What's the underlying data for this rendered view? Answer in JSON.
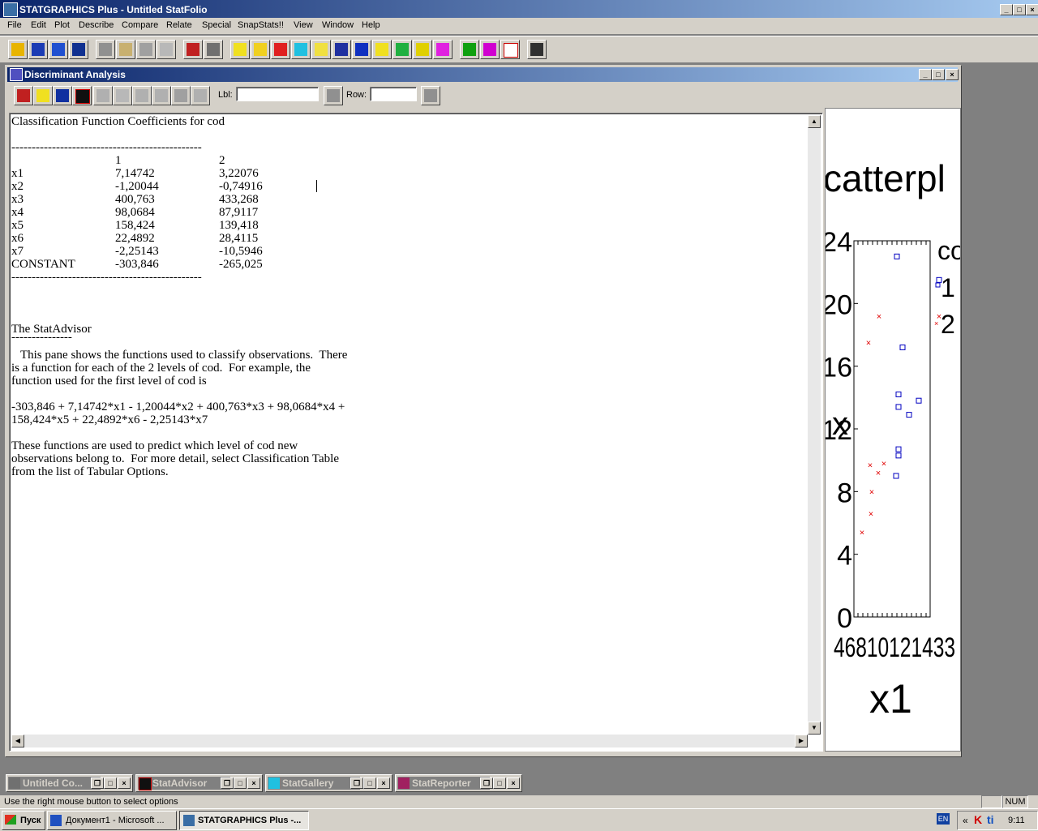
{
  "app": {
    "title": "STATGRAPHICS Plus - Untitled StatFolio",
    "min": "_",
    "max": "□",
    "close": "×"
  },
  "menu": [
    "File",
    "Edit",
    "Plot",
    "Describe",
    "Compare",
    "Relate",
    "Special",
    "SnapStats!!",
    "View",
    "Window",
    "Help"
  ],
  "child": {
    "title": "Discriminant Analysis",
    "lbl_label": "Lbl:",
    "row_label": "Row:",
    "lbl_value": "",
    "row_value": ""
  },
  "output": {
    "heading": "Classification Function Coefficients for cod",
    "rule": "-----------------------------------------------",
    "col_headers": [
      "",
      "1",
      "2"
    ],
    "rows": [
      [
        "x1",
        "7,14742",
        "3,22076"
      ],
      [
        "x2",
        "-1,20044",
        "-0,74916"
      ],
      [
        "x3",
        "400,763",
        "433,268"
      ],
      [
        "x4",
        "98,0684",
        "87,9117"
      ],
      [
        "x5",
        "158,424",
        "139,418"
      ],
      [
        "x6",
        "22,4892",
        "28,4115"
      ],
      [
        "x7",
        "-2,25143",
        "-10,5946"
      ],
      [
        "CONSTANT",
        "-303,846",
        "-265,025"
      ]
    ],
    "advisor_title": "The StatAdvisor",
    "advisor_rule": "---------------",
    "advisor_p1": [
      "   This pane shows the functions used to classify observations.  There",
      "is a function for each of the 2 levels of cod.  For example, the",
      "function used for the first level of cod is"
    ],
    "advisor_p2": [
      "-303,846 + 7,14742*x1 - 1,20044*x2 + 400,763*x3 + 98,0684*x4 +",
      "158,424*x5 + 22,4892*x6 - 2,25143*x7"
    ],
    "advisor_p3": [
      "These functions are used to predict which level of cod new",
      "observations belong to.  For more detail, select Classification Table",
      "from the list of Tabular Options."
    ]
  },
  "graph": {
    "title_fragment": "catterpl",
    "legend_fragment": "co",
    "legend_items": [
      "1",
      "2"
    ],
    "y_ticks": [
      "24",
      "20",
      "16",
      "12",
      "8",
      "4",
      "0"
    ],
    "x_ticks_overlap": "46810121433",
    "xlabel": "x1",
    "ylabel_fragment": "x",
    "colors": {
      "group1": "#0000c0",
      "group2": "#e00000"
    }
  },
  "chart_data": {
    "type": "scatter",
    "title": "",
    "xlabel": "x1",
    "ylabel": "",
    "ylim": [
      0,
      24
    ],
    "series": [
      {
        "name": "1",
        "marker": "square",
        "y": [
          23.0,
          17.2,
          14.2,
          13.4,
          13.8,
          12.9,
          10.7,
          10.3,
          9.0,
          21.5
        ]
      },
      {
        "name": "2",
        "marker": "x",
        "y": [
          19.2,
          17.5,
          9.7,
          9.2,
          9.8,
          8.0,
          6.6,
          5.4,
          19.2
        ]
      }
    ]
  },
  "minimized": [
    {
      "label": "Untitled Co..."
    },
    {
      "label": "StatAdvisor"
    },
    {
      "label": "StatGallery"
    },
    {
      "label": "StatReporter"
    }
  ],
  "status": {
    "message": "Use the right mouse button to select options",
    "num": "NUM"
  },
  "taskbar": {
    "start": "Пуск",
    "tasks": [
      "Документ1 - Microsoft ...",
      "STATGRAPHICS Plus -..."
    ],
    "lang": "EN",
    "time": "9:11"
  }
}
